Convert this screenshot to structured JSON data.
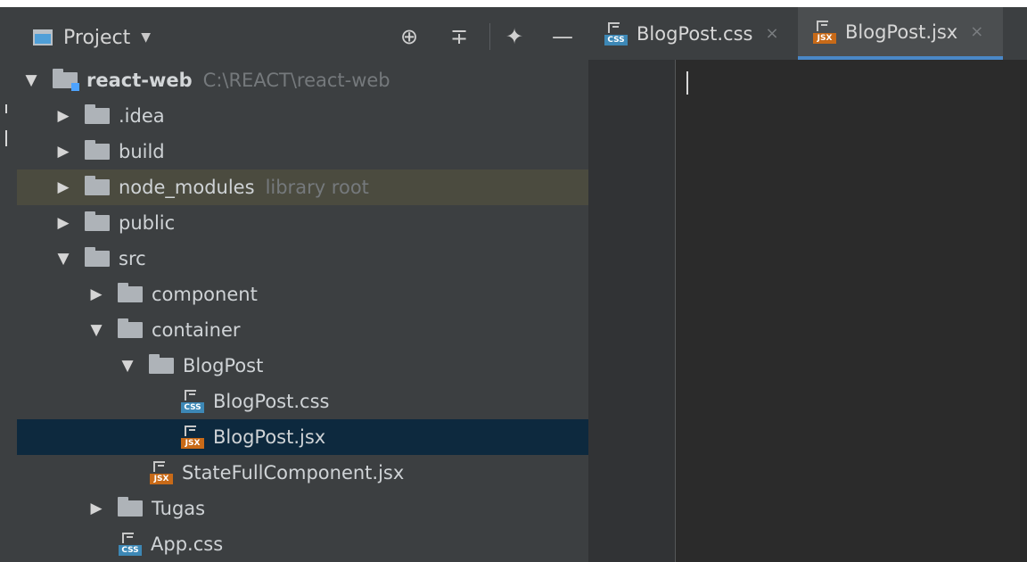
{
  "panel": {
    "title": "Project"
  },
  "tree": [
    {
      "label": "react-web",
      "secondary": "C:\\REACT\\react-web"
    },
    {
      "label": ".idea"
    },
    {
      "label": "build"
    },
    {
      "label": "node_modules",
      "secondary": "library root"
    },
    {
      "label": "public"
    },
    {
      "label": "src"
    },
    {
      "label": "component"
    },
    {
      "label": "container"
    },
    {
      "label": "BlogPost"
    },
    {
      "label": "BlogPost.css",
      "file_type": "CSS"
    },
    {
      "label": "BlogPost.jsx",
      "file_type": "JSX"
    },
    {
      "label": "StateFullComponent.jsx",
      "file_type": "JSX"
    },
    {
      "label": "Tugas"
    },
    {
      "label": "App.css",
      "file_type": "CSS"
    }
  ],
  "tabs": [
    {
      "label": "BlogPost.css",
      "file_type": "CSS"
    },
    {
      "label": "BlogPost.jsx",
      "file_type": "JSX"
    }
  ],
  "icons": {
    "target": "⊕",
    "collapse": "∓",
    "settings": "✦",
    "minimize": "—",
    "close": "×"
  },
  "colors": {
    "panel_background": "#3c3f41",
    "editor_background": "#2b2b2b",
    "selected_row": "#0d293e",
    "library_row": "#4b4b3f",
    "accent": "#4a88c7"
  }
}
